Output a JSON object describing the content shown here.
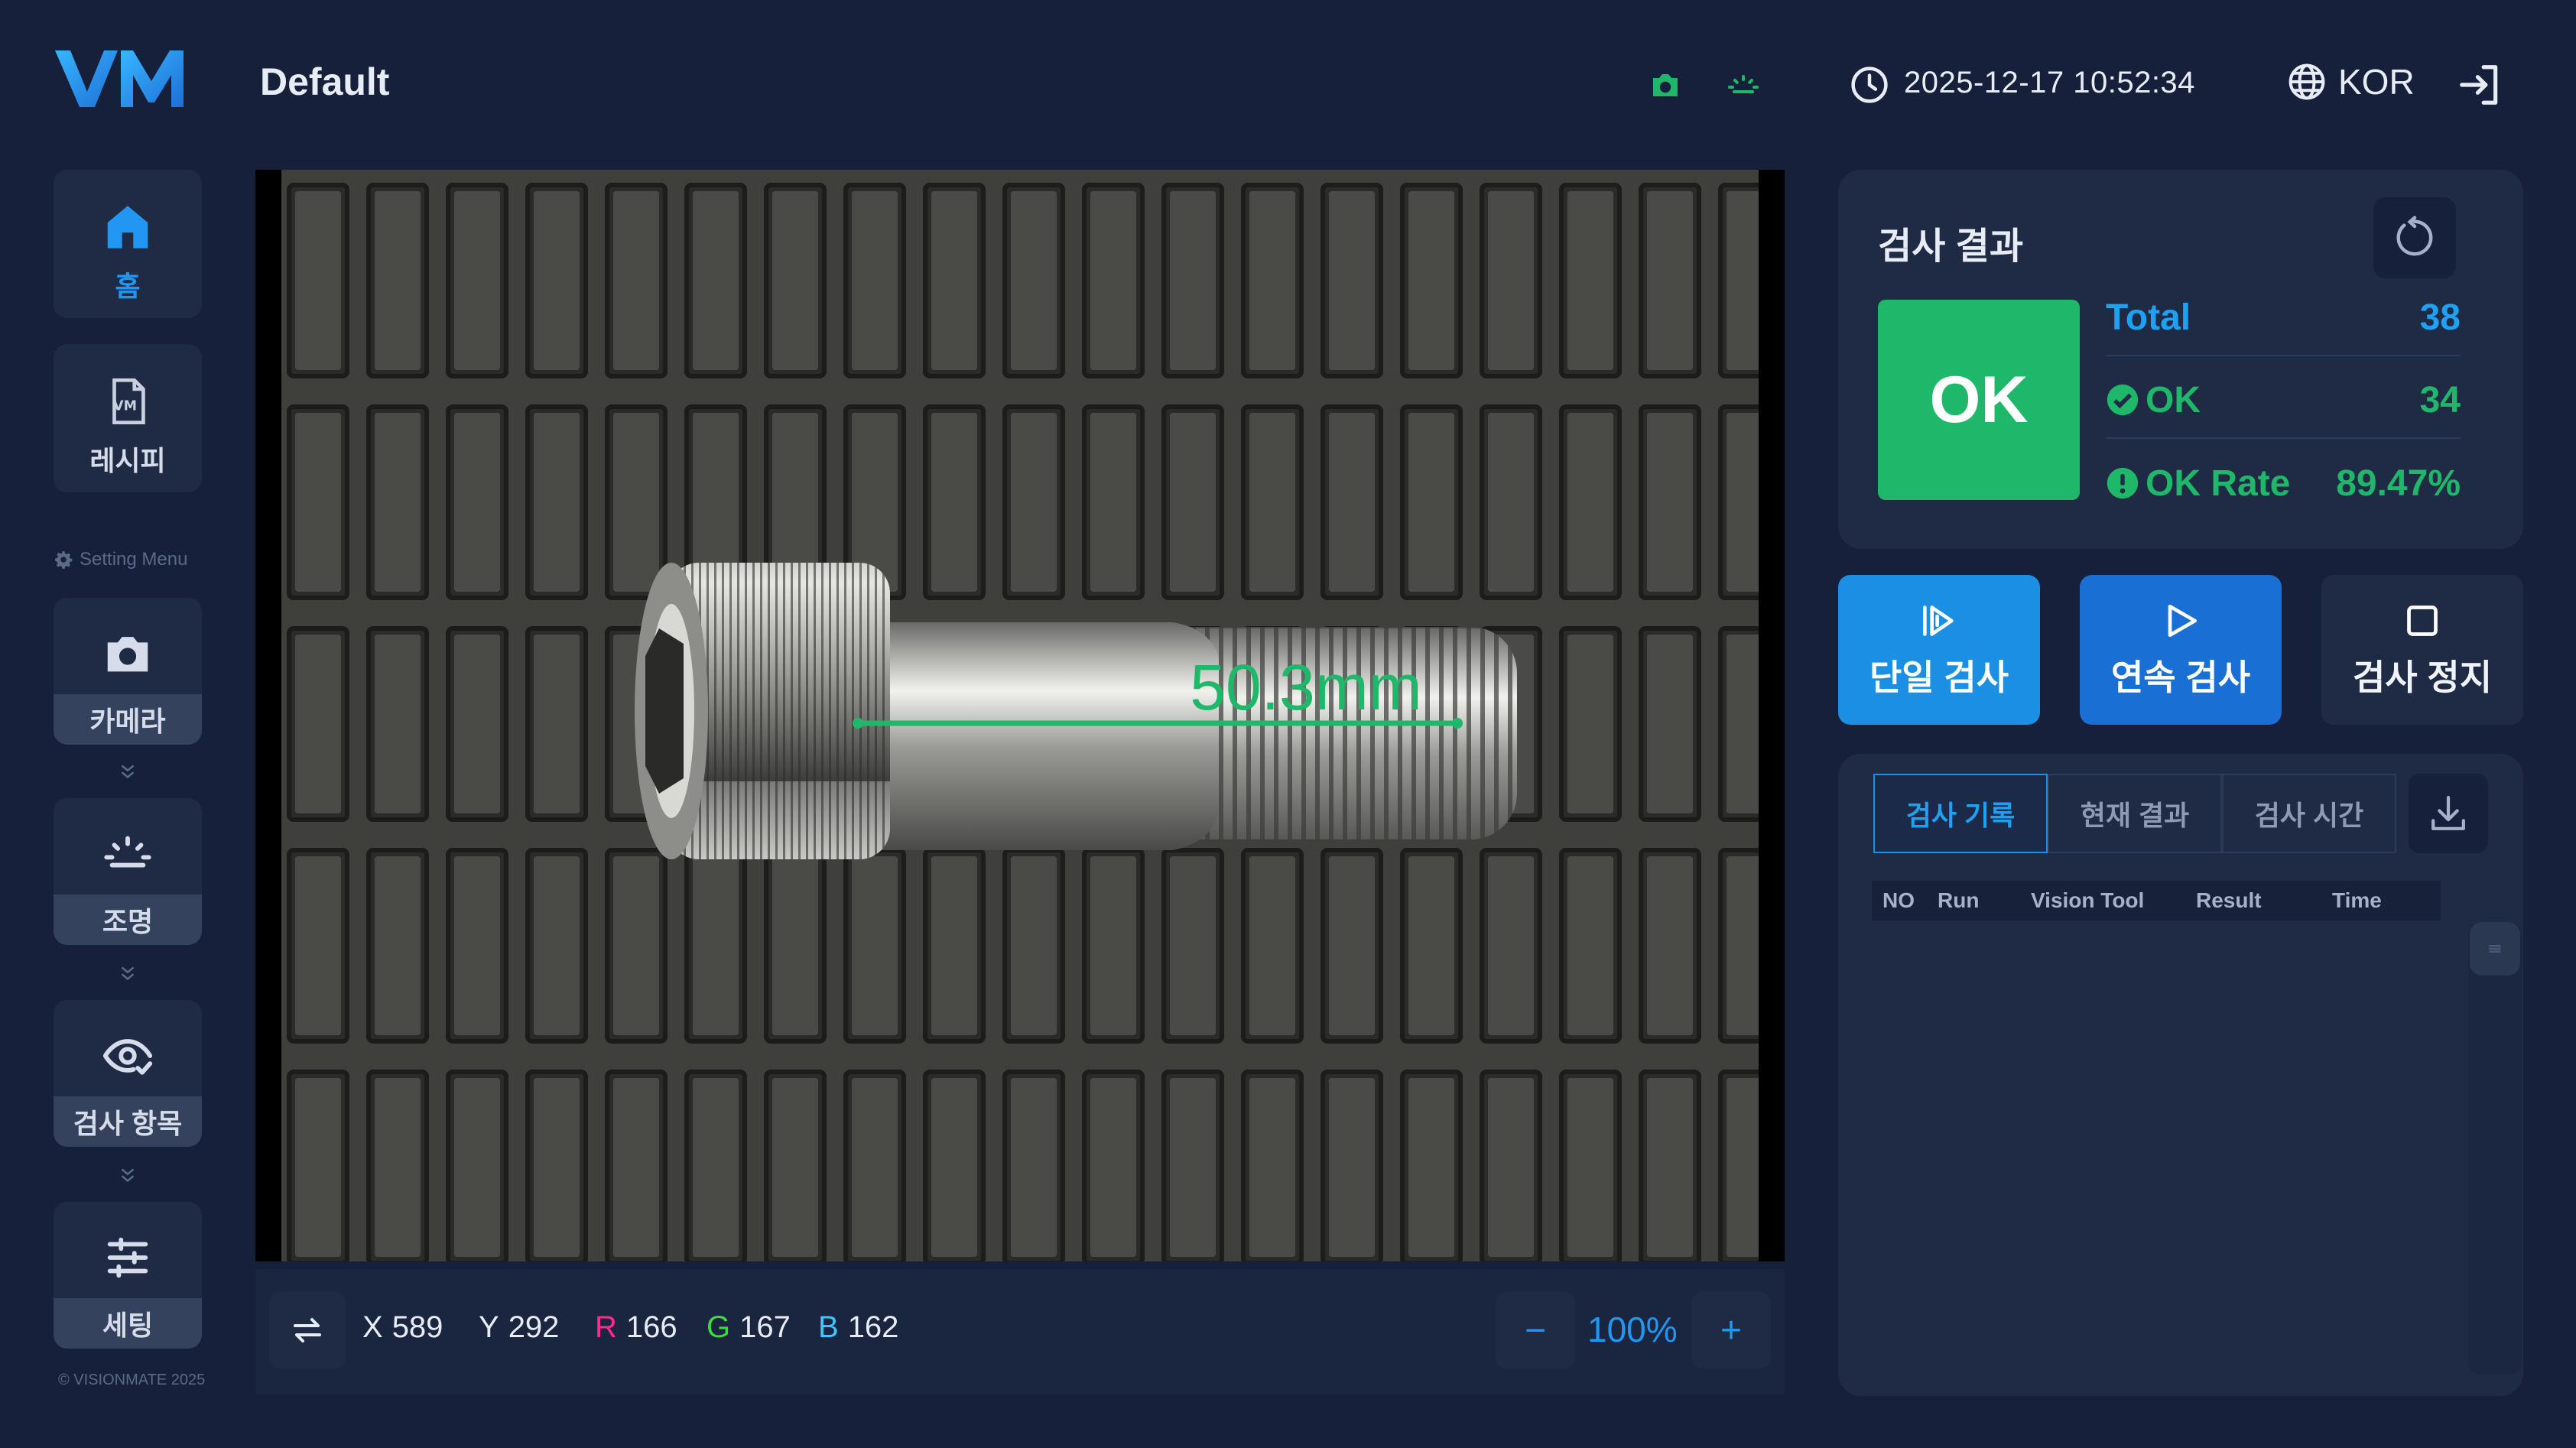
{
  "app": {
    "logo_text": "VM",
    "title": "Default",
    "datetime": "2025-12-17 10:52:34",
    "language": "KOR",
    "copyright": "© VISIONMATE 2025"
  },
  "sidebar": {
    "home": "홈",
    "recipe": "레시피",
    "setting_menu": "Setting Menu",
    "camera": "카메라",
    "light": "조명",
    "inspect_items": "검사 항목",
    "settings": "세팅"
  },
  "viewer": {
    "measurement": "50.3mm"
  },
  "coords": {
    "x_label": "X",
    "x": "589",
    "y_label": "Y",
    "y": "292",
    "r_label": "R",
    "r": "166",
    "g_label": "G",
    "g": "167",
    "b_label": "B",
    "b": "162",
    "zoom_minus": "−",
    "zoom": "100%",
    "zoom_plus": "+"
  },
  "result": {
    "title": "검사 결과",
    "status": "OK",
    "total_label": "Total",
    "total": "38",
    "ok_label": "OK",
    "ok": "34",
    "rate_label": "OK Rate",
    "rate": "89.47%"
  },
  "actions": {
    "single": "단일 검사",
    "continuous": "연속 검사",
    "stop": "검사 정지"
  },
  "history": {
    "tabs": [
      "검사 기록",
      "현재 결과",
      "검사 시간"
    ],
    "columns": [
      "NO",
      "Run",
      "Vision Tool",
      "Result",
      "Time"
    ]
  },
  "colors": {
    "background": "#16203a",
    "panel": "#1f2b44",
    "accent_blue": "#1ea1f2",
    "ok_green": "#1fb86a"
  }
}
